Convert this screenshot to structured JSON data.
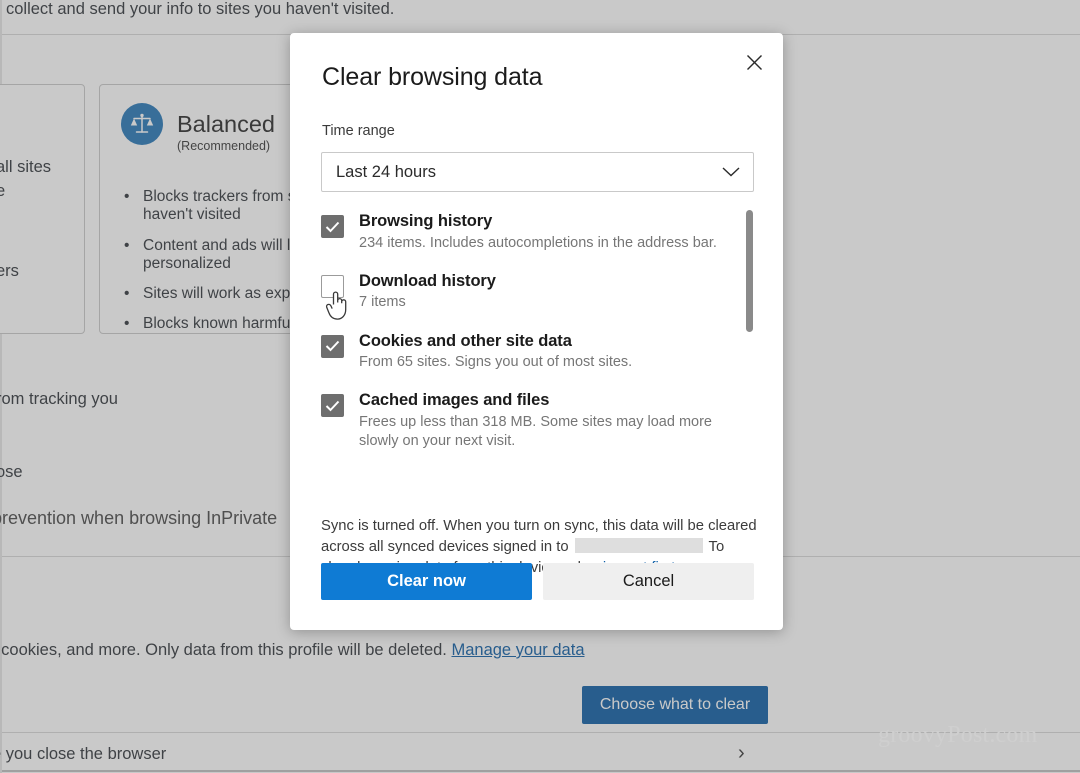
{
  "background": {
    "topbar_text": "collect and send your info to sites you haven't visited.",
    "card_left": {
      "line1": "all sites",
      "line2": "e",
      "line3": "ers"
    },
    "balanced": {
      "title": "Balanced",
      "subtitle": "(Recommended)",
      "icon": "balance-scales-icon",
      "bullets": [
        "Blocks trackers from site\nhaven't visited",
        "Content and ads will lik\npersonalized",
        "Sites will work as expec",
        "Blocks known harmful t"
      ]
    },
    "loose_text_1": "rom tracking you",
    "loose_text_2": "ose",
    "loose_text_3": "prevention when browsing InPrivate",
    "clear_line_prefix": ", cookies, and more. Only data from this profile will be deleted. ",
    "manage_link": "Manage your data",
    "choose_button": "Choose what to clear",
    "close_line": "e you close the browser",
    "chevron": "›"
  },
  "watermark": "groovyPost.com",
  "dialog": {
    "title": "Clear browsing data",
    "close_icon": "close-icon",
    "time_range_label": "Time range",
    "time_range_value": "Last 24 hours",
    "time_range_chevron_icon": "chevron-down-icon",
    "items": [
      {
        "title": "Browsing history",
        "description": "234 items. Includes autocompletions in the address bar.",
        "checked": true
      },
      {
        "title": "Download history",
        "description": "7 items",
        "checked": false
      },
      {
        "title": "Cookies and other site data",
        "description": "From 65 sites. Signs you out of most sites.",
        "checked": true
      },
      {
        "title": "Cached images and files",
        "description": "Frees up less than 318 MB. Some sites may load more slowly on your next visit.",
        "checked": true
      }
    ],
    "sync_text_1": "Sync is turned off. When you turn on sync, this data will be cleared across all synced devices signed in to",
    "sync_text_2": "To clear browsing data from this device only,",
    "sync_link": "sign out first",
    "sync_text_3": ".",
    "primary_button": "Clear now",
    "secondary_button": "Cancel"
  },
  "colors": {
    "accent_blue": "#0f7bd4",
    "dark_blue": "#0f5fa6",
    "link_blue": "#0f5fa6",
    "checkbox_gray": "#6e6e6e",
    "balanced_icon_blue": "#2878b8"
  }
}
